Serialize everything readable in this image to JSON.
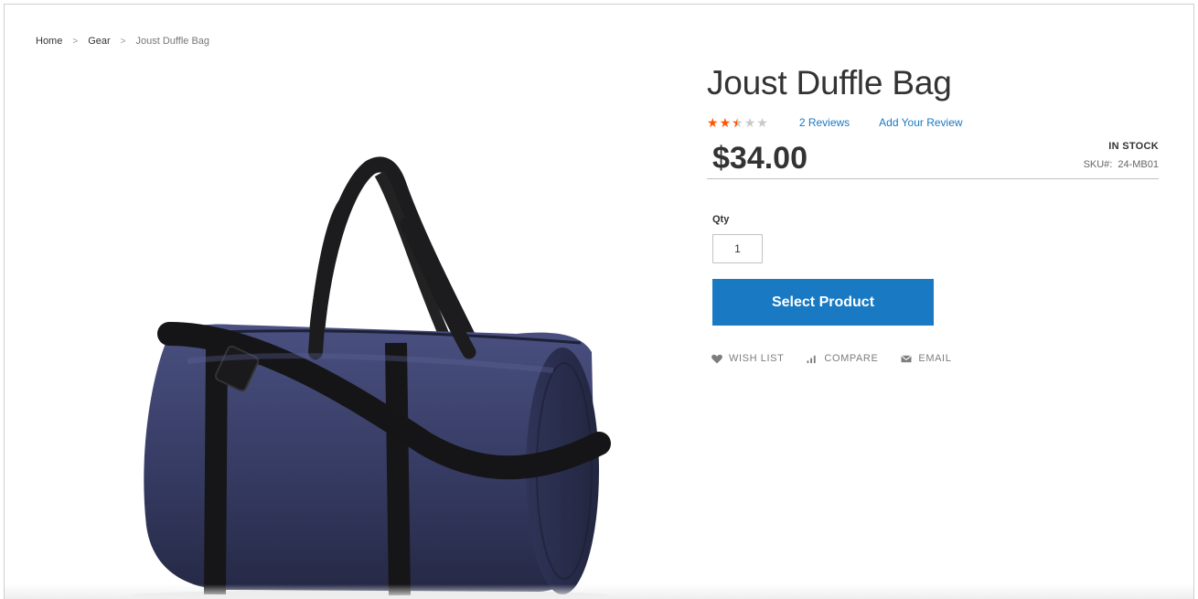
{
  "breadcrumb": {
    "home": "Home",
    "category": "Gear",
    "current": "Joust Duffle Bag",
    "separator": ">"
  },
  "product": {
    "name": "Joust Duffle Bag",
    "rating": {
      "value": 2.5,
      "max": 5
    },
    "reviews_link": "2 Reviews",
    "add_review_link": "Add Your Review",
    "price": "$34.00",
    "stock_status": "IN STOCK",
    "sku_label": "SKU#:",
    "sku": "24-MB01",
    "image_alt_icon": "duffle-bag-product-image"
  },
  "purchase": {
    "qty_label": "Qty",
    "qty_value": "1",
    "button_label": "Select Product"
  },
  "actions": {
    "wish_list": "WISH LIST",
    "compare": "COMPARE",
    "email": "EMAIL"
  },
  "colors": {
    "accent": "#1979c3",
    "star": "#ff5501",
    "bag": "#3a3f66"
  }
}
